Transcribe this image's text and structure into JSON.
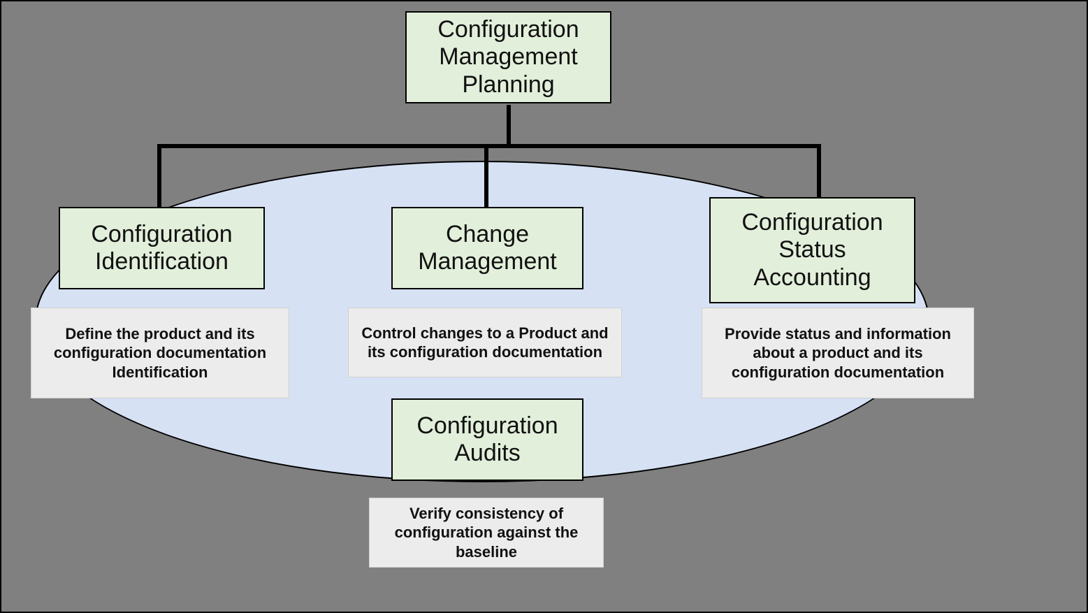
{
  "top": {
    "title": "Configuration Management Planning"
  },
  "columns": [
    {
      "title": "Configuration Identification",
      "desc": "Define the product and its configuration documentation Identification"
    },
    {
      "title": "Change Management",
      "desc": "Control changes to a Product and its configuration documentation"
    },
    {
      "title": "Configuration Status Accounting",
      "desc": "Provide status and information about a product and its configuration documentation"
    }
  ],
  "bottom": {
    "title": "Configuration Audits",
    "desc": "Verify consistency of configuration against the baseline"
  },
  "colors": {
    "background": "#808080",
    "ellipse": "#d6e1f4",
    "box": "#e2efda",
    "desc": "#ececec",
    "border": "#000000"
  }
}
